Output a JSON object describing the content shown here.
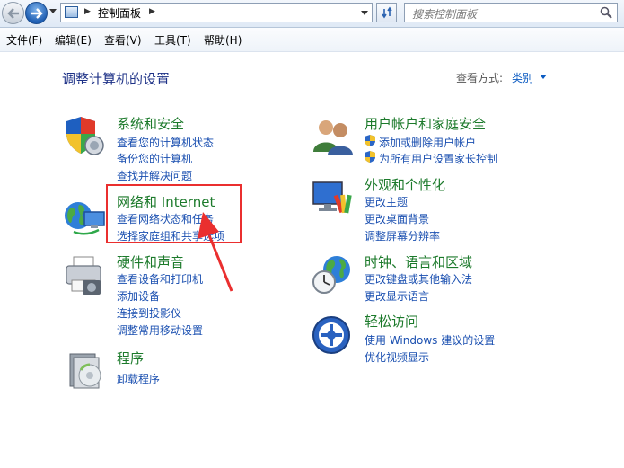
{
  "address": {
    "crumb": "控制面板"
  },
  "search": {
    "placeholder": "搜索控制面板"
  },
  "menu": [
    "文件(F)",
    "编辑(E)",
    "查看(V)",
    "工具(T)",
    "帮助(H)"
  ],
  "page": {
    "heading": "调整计算机的设置",
    "view_by_label": "查看方式:",
    "view_by_value": "类别"
  },
  "categories": [
    {
      "title": "系统和安全",
      "icon": "shield-security-icon",
      "links": [
        "查看您的计算机状态",
        "备份您的计算机",
        "查找并解决问题"
      ]
    },
    {
      "title": "网络和 Internet",
      "icon": "network-globe-icon",
      "links": [
        "查看网络状态和任务",
        "选择家庭组和共享选项"
      ]
    },
    {
      "title": "硬件和声音",
      "icon": "printer-icon",
      "links": [
        "查看设备和打印机",
        "添加设备",
        "连接到投影仪",
        "调整常用移动设置"
      ]
    },
    {
      "title": "程序",
      "icon": "programs-disc-icon",
      "links": [
        "卸载程序"
      ]
    },
    {
      "title": "用户帐户和家庭安全",
      "icon": "users-icon",
      "links": [
        "添加或删除用户帐户",
        "为所有用户设置家长控制"
      ]
    },
    {
      "title": "外观和个性化",
      "icon": "monitor-palette-icon",
      "links": [
        "更改主题",
        "更改桌面背景",
        "调整屏幕分辨率"
      ]
    },
    {
      "title": "时钟、语言和区域",
      "icon": "clock-globe-icon",
      "links": [
        "更改键盘或其他输入法",
        "更改显示语言"
      ]
    },
    {
      "title": "轻松访问",
      "icon": "ease-of-access-icon",
      "links": [
        "使用 Windows 建议的设置",
        "优化视频显示"
      ]
    }
  ],
  "colors": {
    "category_title": "#1c7a2b",
    "link": "#1a4fb0",
    "heading": "#1e3287",
    "annotation": "#ea2f2f"
  }
}
